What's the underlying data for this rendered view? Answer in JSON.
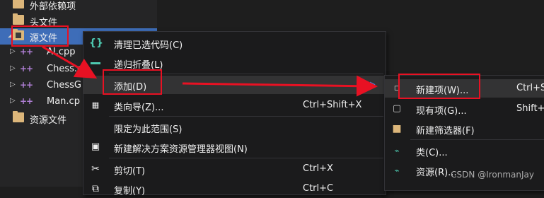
{
  "tree": {
    "items": [
      {
        "label": "外部依赖项",
        "type": "folder"
      },
      {
        "label": "头文件",
        "type": "folder"
      },
      {
        "label": "源文件",
        "type": "folder-src"
      },
      {
        "label": "AI.cpp",
        "type": "cpp"
      },
      {
        "label": "Chess.c",
        "type": "cpp"
      },
      {
        "label": "ChessG",
        "type": "cpp"
      },
      {
        "label": "Man.cp",
        "type": "cpp"
      },
      {
        "label": "资源文件",
        "type": "folder"
      }
    ]
  },
  "context_menu": {
    "items": [
      {
        "label": "清理已选代码(C)",
        "shortcut": "",
        "icon": "braces-icon"
      },
      {
        "label": "递归折叠(L)",
        "shortcut": "",
        "icon": "collapse-icon"
      },
      {
        "label": "添加(D)",
        "shortcut": "",
        "icon": ""
      },
      {
        "label": "类向导(Z)...",
        "shortcut": "Ctrl+Shift+X",
        "icon": "class-wizard-icon"
      },
      {
        "label": "限定为此范围(S)",
        "shortcut": "",
        "icon": ""
      },
      {
        "label": "新建解决方案资源管理器视图(N)",
        "shortcut": "",
        "icon": "new-view-icon"
      },
      {
        "label": "剪切(T)",
        "shortcut": "Ctrl+X",
        "icon": "scissors-icon"
      },
      {
        "label": "复制(Y)",
        "shortcut": "Ctrl+C",
        "icon": "copy-icon"
      }
    ]
  },
  "submenu": {
    "items": [
      {
        "label": "新建项(W)...",
        "shortcut": "Ctrl+S",
        "icon": "new-item-icon"
      },
      {
        "label": "现有项(G)...",
        "shortcut": "Shift+",
        "icon": "existing-item-icon"
      },
      {
        "label": "新建筛选器(F)",
        "shortcut": "",
        "icon": "new-filter-icon"
      },
      {
        "label": "类(C)...",
        "shortcut": "",
        "icon": "class-icon"
      },
      {
        "label": "资源(R)...",
        "shortcut": "",
        "icon": "resource-icon"
      }
    ]
  },
  "watermark": "CSDN @IronmanJay",
  "colors": {
    "annotation": "#e81123",
    "selection": "#3e6db8",
    "menu_bg": "#1b1b1c"
  }
}
